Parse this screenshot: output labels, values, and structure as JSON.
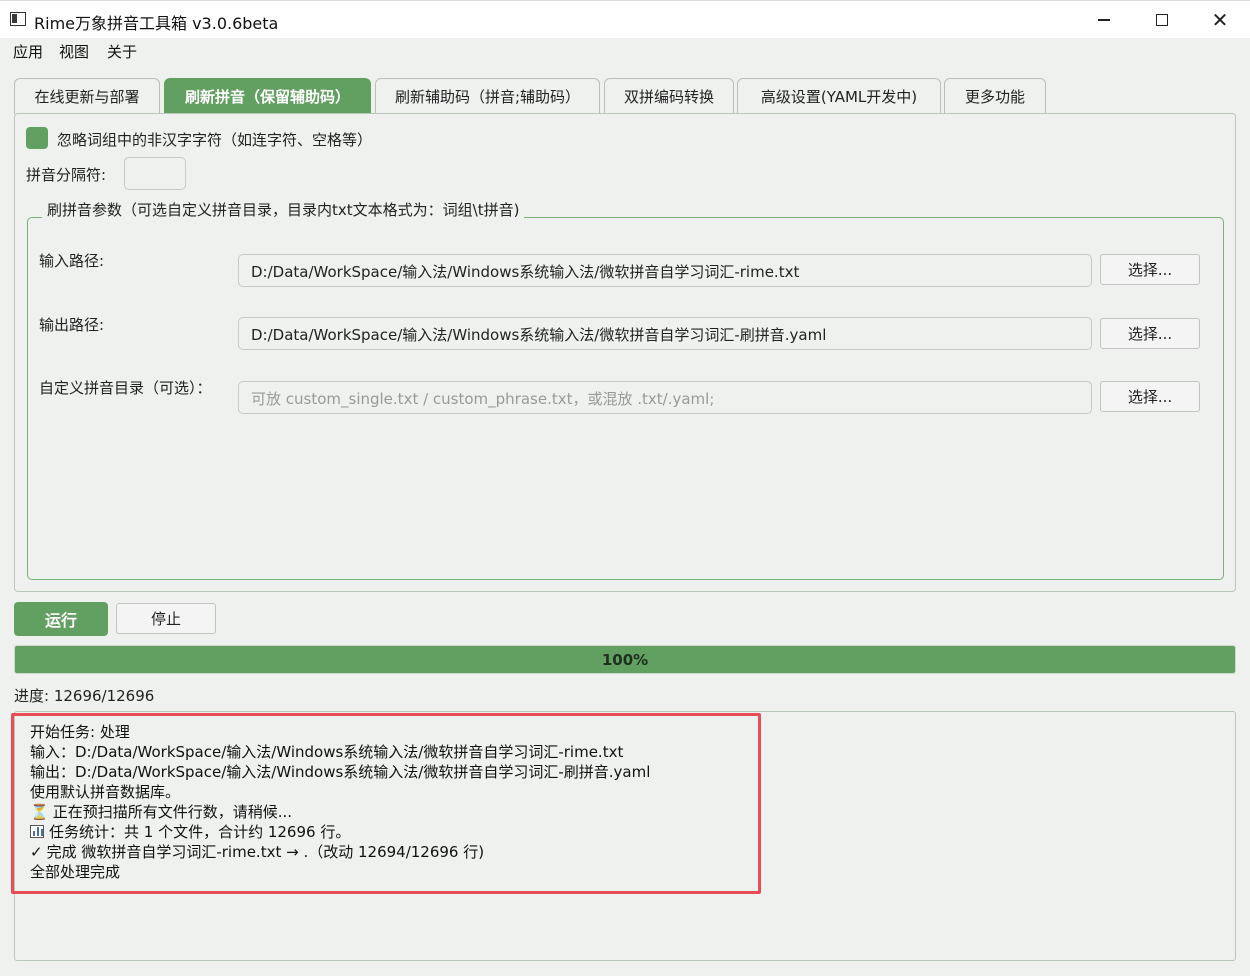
{
  "window": {
    "title": "Rime万象拼音工具箱 v3.0.6beta"
  },
  "menu": [
    "应用",
    "视图",
    "关于"
  ],
  "tabs": [
    {
      "label": "在线更新与部署",
      "active": false
    },
    {
      "label": "刷新拼音（保留辅助码）",
      "active": true
    },
    {
      "label": "刷新辅助码（拼音;辅助码）",
      "active": false
    },
    {
      "label": "双拼编码转换",
      "active": false
    },
    {
      "label": "高级设置(YAML开发中)",
      "active": false
    },
    {
      "label": "更多功能",
      "active": false
    }
  ],
  "options": {
    "ignore_non_hanzi_label": "忽略词组中的非汉字字符（如连字符、空格等）",
    "ignore_non_hanzi_checked": true,
    "separator_label": "拼音分隔符:",
    "separator_value": ""
  },
  "params": {
    "group_title": "刷拼音参数（可选自定义拼音目录，目录内txt文本格式为：词组\\t拼音)",
    "input_label": "输入路径:",
    "input_value": "D:/Data/WorkSpace/输入法/Windows系统输入法/微软拼音自学习词汇-rime.txt",
    "output_label": "输出路径:",
    "output_value": "D:/Data/WorkSpace/输入法/Windows系统输入法/微软拼音自学习词汇-刷拼音.yaml",
    "custom_label": "自定义拼音目录（可选）：",
    "custom_placeholder": "可放 custom_single.txt / custom_phrase.txt，或混放 .txt/.yaml;",
    "choose_label": "选择..."
  },
  "actions": {
    "run_label": "运行",
    "stop_label": "停止"
  },
  "progress": {
    "percent_text": "100%",
    "fraction": 1.0,
    "count_text": "进度: 12696/12696"
  },
  "log": [
    {
      "icon": "",
      "text": "开始任务: 处理"
    },
    {
      "icon": "",
      "text": "输入：D:/Data/WorkSpace/输入法/Windows系统输入法/微软拼音自学习词汇-rime.txt"
    },
    {
      "icon": "",
      "text": "输出：D:/Data/WorkSpace/输入法/Windows系统输入法/微软拼音自学习词汇-刷拼音.yaml"
    },
    {
      "icon": "",
      "text": "使用默认拼音数据库。"
    },
    {
      "icon": "hourglass-icon",
      "text": "正在预扫描所有文件行数，请稍候..."
    },
    {
      "icon": "bar-chart-icon",
      "text": "任务统计：共 1 个文件，合计约 12696 行。"
    },
    {
      "icon": "check-icon",
      "text": "完成 微软拼音自学习词汇-rime.txt → .（改动 12694/12696 行)"
    },
    {
      "icon": "",
      "text": "全部处理完成"
    }
  ],
  "colors": {
    "accent": "#62a062",
    "highlight": "#e84c55"
  }
}
